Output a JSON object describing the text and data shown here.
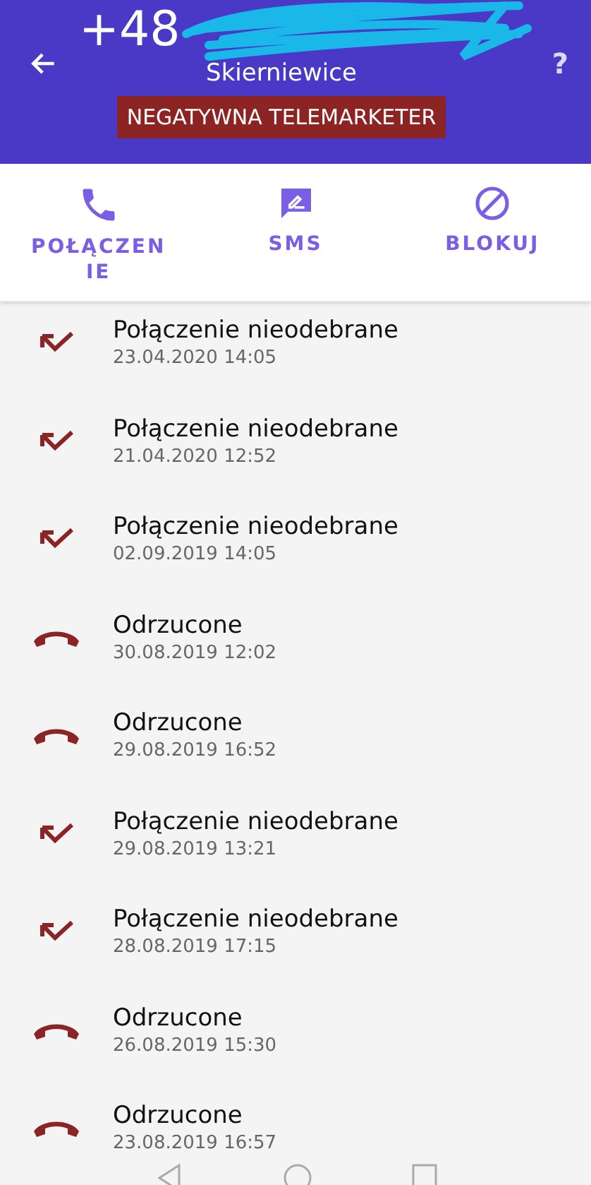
{
  "header": {
    "number": "+48",
    "location": "Skierniewice",
    "help": "?",
    "badge": "NEGATYWNA TELEMARKETER"
  },
  "actions": [
    {
      "kind": "call",
      "label": "POŁĄCZEN IE"
    },
    {
      "kind": "sms",
      "label": "SMS"
    },
    {
      "kind": "block",
      "label": "BLOKUJ"
    }
  ],
  "calls": [
    {
      "kind": "missed",
      "title": "Połączenie nieodebrane",
      "time": "23.04.2020 14:05"
    },
    {
      "kind": "missed",
      "title": "Połączenie nieodebrane",
      "time": "21.04.2020 12:52"
    },
    {
      "kind": "missed",
      "title": "Połączenie nieodebrane",
      "time": "02.09.2019 14:05"
    },
    {
      "kind": "rejected",
      "title": "Odrzucone",
      "time": "30.08.2019 12:02"
    },
    {
      "kind": "rejected",
      "title": "Odrzucone",
      "time": "29.08.2019 16:52"
    },
    {
      "kind": "missed",
      "title": "Połączenie nieodebrane",
      "time": "29.08.2019 13:21"
    },
    {
      "kind": "missed",
      "title": "Połączenie nieodebrane",
      "time": "28.08.2019 17:15"
    },
    {
      "kind": "rejected",
      "title": "Odrzucone",
      "time": "26.08.2019 15:30"
    },
    {
      "kind": "rejected",
      "title": "Odrzucone",
      "time": "23.08.2019 16:57"
    }
  ]
}
